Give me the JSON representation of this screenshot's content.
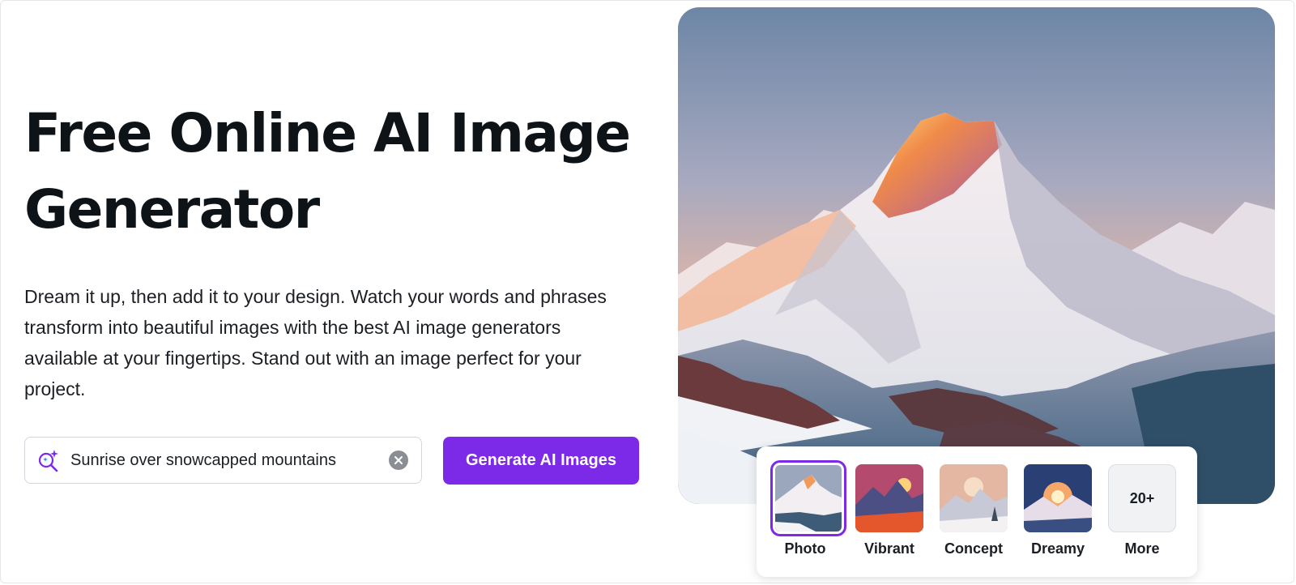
{
  "hero": {
    "title_line1": "Free Online AI Image",
    "title_line2": "Generator",
    "description": "Dream it up, then add it to your design. Watch your words and phrases transform into beautiful images with the best AI image generators available at your fingertips. Stand out with an image perfect for your project."
  },
  "prompt": {
    "value": "Sunrise over snowcapped mountains",
    "icon": "magic-search-icon",
    "clear_icon": "clear-icon"
  },
  "generate_button": {
    "label": "Generate AI Images"
  },
  "styles": [
    {
      "label": "Photo",
      "selected": true
    },
    {
      "label": "Vibrant",
      "selected": false
    },
    {
      "label": "Concept",
      "selected": false
    },
    {
      "label": "Dreamy",
      "selected": false
    },
    {
      "label": "More",
      "selected": false,
      "badge": "20+"
    }
  ],
  "colors": {
    "accent": "#7d2ae8",
    "text": "#0e1318"
  }
}
